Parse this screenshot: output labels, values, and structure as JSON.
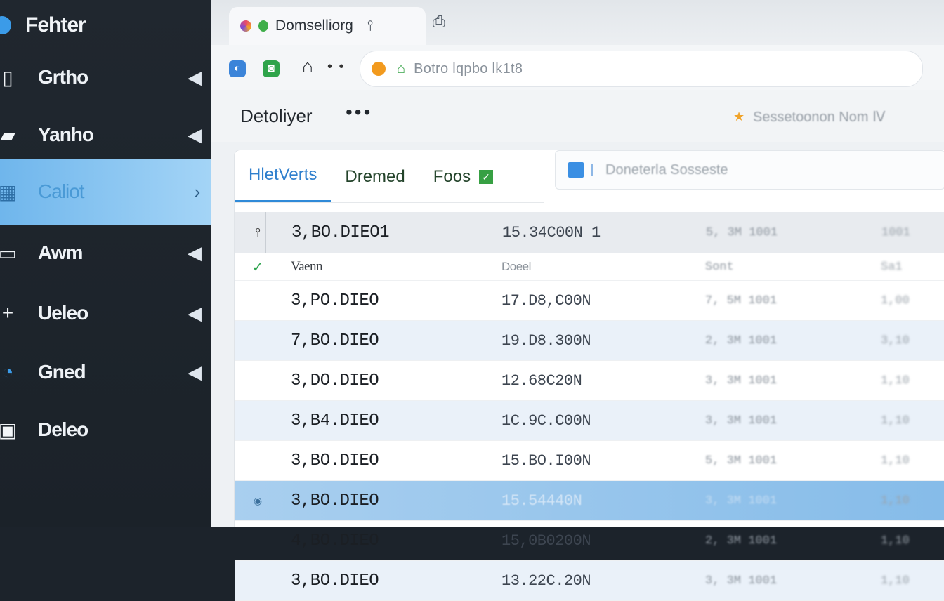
{
  "sidebar": {
    "brand": "Fehter",
    "items": [
      {
        "label": "Grtho",
        "icon": "document-icon",
        "glyph": "▯",
        "chevron": "◀"
      },
      {
        "label": "Yanho",
        "icon": "folder-icon",
        "glyph": "▰",
        "chevron": "◀"
      },
      {
        "label": "Caliot",
        "icon": "grid-icon",
        "glyph": "▦",
        "chevron": "›",
        "active": true
      },
      {
        "label": "Awm",
        "icon": "window-icon",
        "glyph": "▭",
        "chevron": "◀"
      },
      {
        "label": "Ueleo",
        "icon": "plus-icon",
        "glyph": "+",
        "chevron": "◀"
      },
      {
        "label": "Gned",
        "icon": "user-icon",
        "glyph": "◔",
        "chevron": "◀"
      },
      {
        "label": "Deleo",
        "icon": "lock-icon",
        "glyph": "▣",
        "chevron": ""
      }
    ]
  },
  "browser": {
    "tab_title": "Domselliorg",
    "tab_pin": "⫯",
    "new_tab": "⎙",
    "toolbar_dots": "• •",
    "home_glyph": "⌂",
    "ext1_glyph": "◐",
    "ext2_glyph": "◙",
    "omnibox_lock": "⌂",
    "url": "Botro lqpbo lk1t8",
    "page_title": "Detoliyer",
    "page_more": "•••",
    "bookmark_star": "★",
    "bookmark_text": "Sessetoonon  Nom  Ⅳ"
  },
  "content": {
    "tabs": [
      {
        "label": "HletVerts",
        "active": true
      },
      {
        "label": "Dremed"
      },
      {
        "label": "Foos"
      }
    ],
    "tab_badge": "✓",
    "search_placeholder": "Doneterla Sosseste",
    "header": {
      "check": "⫯",
      "c1": "3,BO.DIEO1",
      "c2": "15.34C00N 1",
      "c3": "5, 3M 1001",
      "c4": "1001"
    },
    "subheader": {
      "check": "✓",
      "c1": "Vaenn",
      "c2": "Doeel",
      "c3": "Sont",
      "c4": "Sa1"
    },
    "rows": [
      {
        "c1": "3,PO.DIEO",
        "c2": "17.D8,C00N",
        "c3": "7, 5M 1001",
        "c4": "1,00",
        "style": "plain"
      },
      {
        "c1": "7,BO.DIEO",
        "c2": "19.D8.300N",
        "c3": "2, 3M 1001",
        "c4": "3,10",
        "style": "alt"
      },
      {
        "c1": "3,DO.DIEO",
        "c2": "12.68C20N",
        "c3": "3, 3M 1001",
        "c4": "1,10",
        "style": "plain"
      },
      {
        "c1": "3,B4.DIEO",
        "c2": "1C.9C.C00N",
        "c3": "3, 3M 1001",
        "c4": "1,10",
        "style": "alt"
      },
      {
        "c1": "3,BO.DIEO",
        "c2": "15.BO.I00N",
        "c3": "5, 3M 1001",
        "c4": "1,10",
        "style": "plain"
      },
      {
        "c1": "3,BO.DIEO",
        "c2": "15.54440N",
        "c3": "3, 3M 1001",
        "c4": "1,10",
        "style": "selected",
        "check": "◉"
      },
      {
        "c1": "4,BO.DIEO",
        "c2": "15,0B0200N",
        "c3": "2, 3M 1001",
        "c4": "1,10",
        "style": "plain"
      },
      {
        "c1": "3,BO.DIEO",
        "c2": "13.22C.20N",
        "c3": "3, 3M 1001",
        "c4": "1,10",
        "style": "alt"
      }
    ]
  },
  "colors": {
    "sidebar_bg": "#1e252d",
    "active_item": "#8cc6f0",
    "accent": "#2f8ad8",
    "selected_row": "#93c4ec"
  }
}
